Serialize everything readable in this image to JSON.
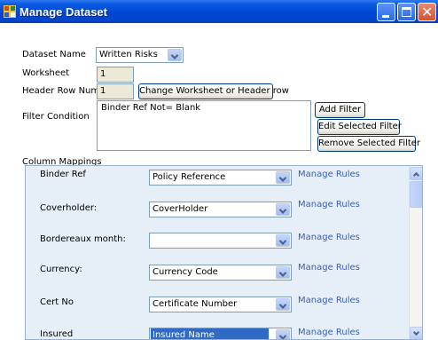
{
  "window": {
    "title": "Manage Dataset",
    "colors": {
      "titlebar": "#0046d5",
      "close_button": "#d2542f",
      "panel_bg": "#e6eef8",
      "link": "#3b5fb8",
      "selection": "#316ac5"
    }
  },
  "form": {
    "dataset_name_label": "Dataset Name",
    "dataset_name_value": "Written Risks",
    "worksheet_label": "Worksheet",
    "worksheet_value": "1",
    "header_row_label": "Header Row Number",
    "header_row_value": "1",
    "change_button": "Change Worksheet or Header row",
    "filter_label": "Filter Condition",
    "filter_value": "Binder Ref Not= Blank",
    "add_filter": "Add Filter",
    "edit_filter": "Edit Selected Filter",
    "remove_filter": "Remove Selected Filter",
    "column_mappings_label": "Column Mappings"
  },
  "mappings": [
    {
      "label": "Binder Ref",
      "value": "Policy Reference",
      "action": "Manage Rules"
    },
    {
      "label": "Coverholder:",
      "value": "CoverHolder",
      "action": "Manage Rules"
    },
    {
      "label": "Bordereaux month:",
      "value": "",
      "action": "Manage Rules"
    },
    {
      "label": "Currency:",
      "value": "Currency Code",
      "action": "Manage Rules"
    },
    {
      "label": "Cert No",
      "value": "Certificate Number",
      "action": "Manage Rules"
    },
    {
      "label": "Insured",
      "value": "Insured Name",
      "action": "Manage Rules"
    }
  ]
}
